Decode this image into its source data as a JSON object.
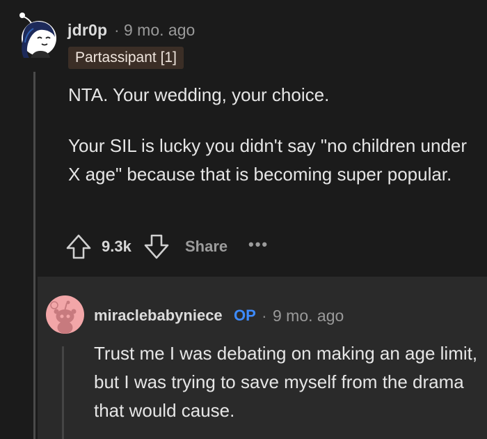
{
  "comment": {
    "username": "jdr0p",
    "separator": "·",
    "timestamp": "9 mo. ago",
    "flair": "Partassipant [1]",
    "paragraphs": [
      "NTA. Your wedding, your choice.",
      "Your SIL is lucky you didn't say \"no children under X age\" because that is becoming super popular."
    ],
    "actions": {
      "upvote_icon": "upvote-arrow-icon",
      "vote_count": "9.3k",
      "downvote_icon": "downvote-arrow-icon",
      "share_label": "Share",
      "more_label": "•••"
    }
  },
  "reply": {
    "username": "miraclebabyniece",
    "op_badge": "OP",
    "separator": "·",
    "timestamp": "9 mo. ago",
    "body": "Trust me I was debating on making an age limit, but I was trying to save myself from the drama that would cause."
  },
  "colors": {
    "background": "#1b1b1b",
    "reply_background": "#2a2a2a",
    "flair_background": "#3b2e26",
    "op_blue": "#3d8bff",
    "avatar_pink": "#f2a6a8"
  }
}
